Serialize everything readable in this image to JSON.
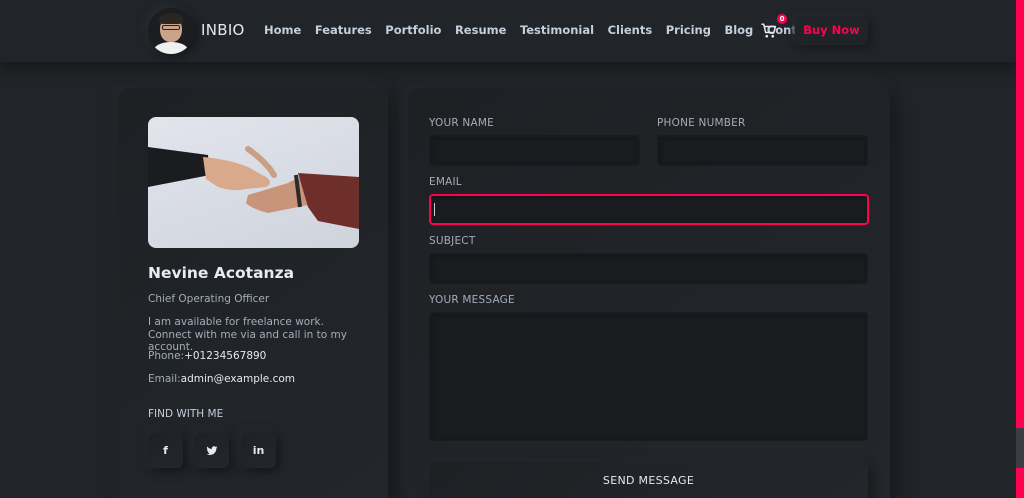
{
  "brand": {
    "name": "INBIO",
    "accent": "#ff014f"
  },
  "nav": {
    "items": [
      "Home",
      "Features",
      "Portfolio",
      "Resume",
      "Testimonial",
      "Clients",
      "Pricing",
      "Blog",
      "Contacts"
    ],
    "cart_count": "0",
    "buy_label": "Buy Now"
  },
  "contact_card": {
    "name": "Nevine Acotanza",
    "role": "Chief Operating Officer",
    "description": "I am available for freelance work. Connect with me via and call in to my account.",
    "phone_label": "Phone:",
    "phone_value": "+01234567890",
    "email_label": "Email:",
    "email_value": "admin@example.com",
    "find_label": "FIND WITH ME",
    "social": [
      "f",
      "t",
      "in"
    ]
  },
  "form": {
    "name_label": "YOUR NAME",
    "phone_label": "PHONE NUMBER",
    "email_label": "EMAIL",
    "subject_label": "SUBJECT",
    "message_label": "YOUR MESSAGE",
    "submit_label": "SEND MESSAGE"
  }
}
